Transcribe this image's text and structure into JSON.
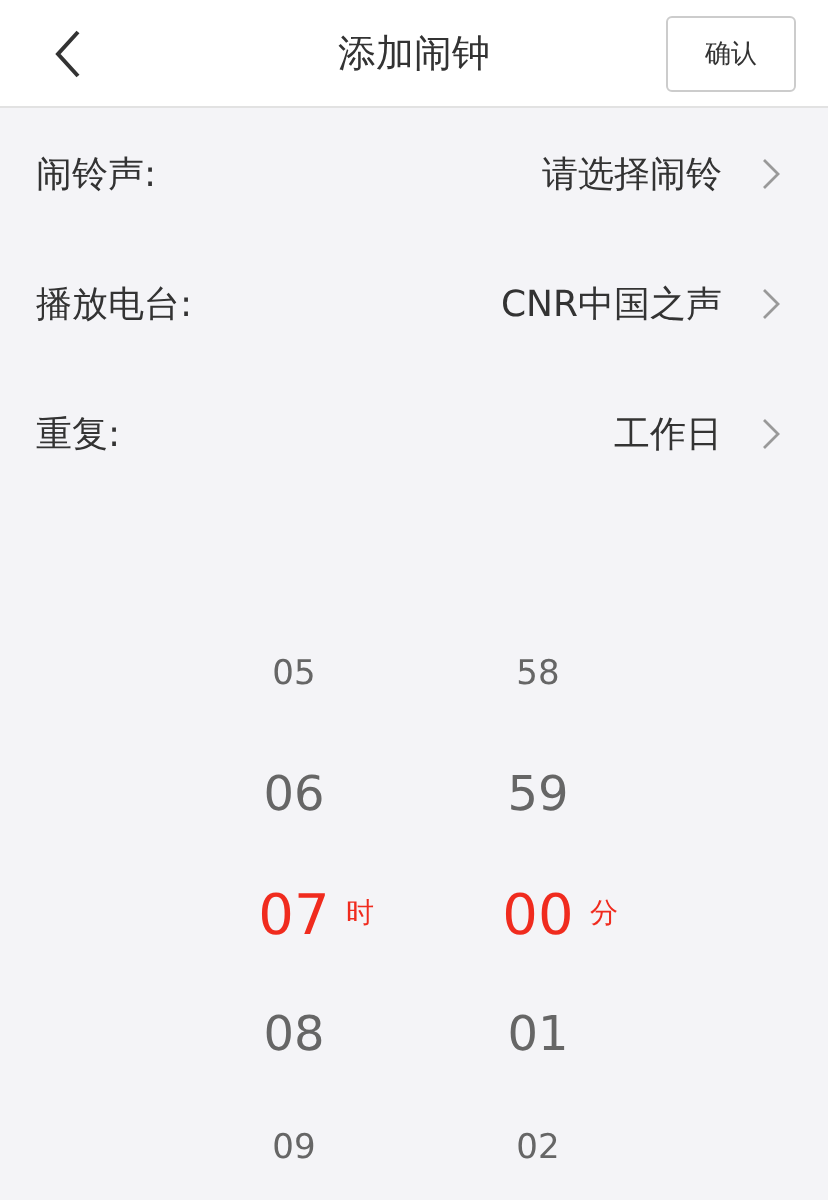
{
  "header": {
    "title": "添加闹钟",
    "confirm_button": "确认"
  },
  "settings": [
    {
      "label": "闹铃声:",
      "value": "请选择闹铃"
    },
    {
      "label": "播放电台:",
      "value": "CNR中国之声"
    },
    {
      "label": "重复:",
      "value": "工作日"
    }
  ],
  "time_picker": {
    "columns": [
      {
        "unit": "时",
        "items": [
          {
            "text": "05",
            "selected": false
          },
          {
            "text": "06",
            "selected": false
          },
          {
            "text": "07",
            "selected": true
          },
          {
            "text": "08",
            "selected": false
          },
          {
            "text": "09",
            "selected": false
          }
        ]
      },
      {
        "unit": "分",
        "items": [
          {
            "text": "58",
            "selected": false
          },
          {
            "text": "59",
            "selected": false
          },
          {
            "text": "00",
            "selected": true
          },
          {
            "text": "01",
            "selected": false
          },
          {
            "text": "02",
            "selected": false
          }
        ]
      }
    ]
  }
}
